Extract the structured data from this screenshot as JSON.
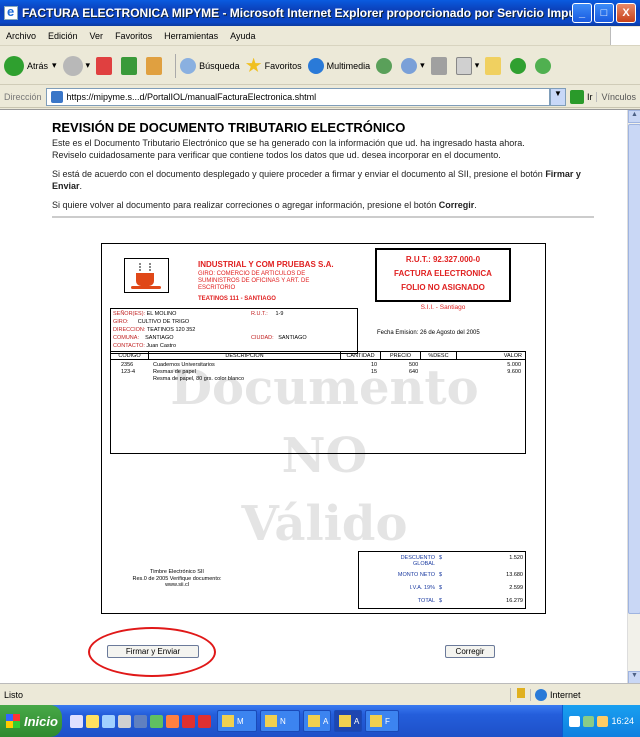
{
  "window": {
    "title": "FACTURA ELECTRONICA MIPYME - Microsoft Internet Explorer proporcionado por Servicio Impuestos Interno",
    "minimize": "_",
    "maximize": "□",
    "close": "X"
  },
  "menu": [
    "Archivo",
    "Edición",
    "Ver",
    "Favoritos",
    "Herramientas",
    "Ayuda"
  ],
  "toolbar": {
    "back": "Atrás",
    "search": "Búsqueda",
    "favorites": "Favoritos",
    "multimedia": "Multimedia"
  },
  "address": {
    "label": "Dirección",
    "url": "https://mipyme.s...d/PortalIOL/manualFacturaElectronica.shtml",
    "go": "Ir",
    "links": "Vínculos"
  },
  "page": {
    "heading": "REVISIÓN DE DOCUMENTO TRIBUTARIO ELECTRÓNICO",
    "intro1": "Este es el Documento Tributario Electrónico que se ha generado con la información que ud. ha ingresado hasta ahora.",
    "intro2": "Reviselo cuidadosamente para verificar que contiene todos los datos que ud. desea incorporar en el documento.",
    "sign1": "Si está de acuerdo con el documento desplegado y quiere proceder a firmar y enviar el documento al SII, presione el botón",
    "sign_btn_name": "Firmar y Enviar",
    "correct_text": "Si quiere volver al documento para realizar correciones o agregar información, presione el botón",
    "correct_btn_name": "Corregir"
  },
  "invoice": {
    "emisor_name": "INDUSTRIAL Y COM PRUEBAS S.A.",
    "emisor_giro": "GIRO: COMERCIO DE ARTICULOS DE SUMINISTROS DE OFICINAS Y ART. DE ESCRITORIO",
    "emisor_dir": "TEATINOS 111 - SANTIAGO",
    "rut": "R.U.T.: 92.327.000-0",
    "doc_type": "FACTURA ELECTRONICA",
    "folio": "FOLIO NO ASIGNADO",
    "sii": "S.I.I. - Santiago",
    "receptor": {
      "senores_k": "SEÑOR(ES):",
      "senores_v": "EL MOLINO",
      "rut_k": "R.U.T.:",
      "rut_v": "1-9",
      "giro_k": "GIRO:",
      "giro_v": "CULTIVO DE TRIGO",
      "dir_k": "DIRECCION:",
      "dir_v": "TEATINOS 120 352",
      "comuna_k": "COMUNA:",
      "comuna_v": "SANTIAGO",
      "ciudad_k": "CIUDAD:",
      "ciudad_v": "SANTIAGO",
      "contacto_k": "CONTACTO:",
      "contacto_v": "Juan Castro"
    },
    "fecha": "Fecha Emision: 26 de Agosto del 2005",
    "columns": [
      "CODIGO",
      "DESCRIPCION",
      "CANTIDAD",
      "PRECIO",
      "%DESC",
      "VALOR"
    ],
    "items": [
      {
        "codigo": "2356",
        "desc": "Cuadernos Universitarios",
        "cant": "10",
        "precio": "500",
        "valor": "5.000"
      },
      {
        "codigo": "123-4",
        "desc": "Resmas de papel",
        "cant": "15",
        "precio": "640",
        "valor": "9.600"
      }
    ],
    "item_note": "Resma de papel, 80 grs. color blanco",
    "watermark": [
      "Documento",
      "NO",
      "Válido"
    ],
    "timbre": [
      "Timbre Electrónico SII",
      "Res.0 de 2005 Verifique documento:",
      "www.sii.cl"
    ],
    "totals": [
      {
        "k": "DESCUENTO GLOBAL",
        "s": "$",
        "v": "1.520"
      },
      {
        "k": "MONTO NETO",
        "s": "$",
        "v": "13.680"
      },
      {
        "k": "I.V.A. 19%",
        "s": "$",
        "v": "2.599"
      },
      {
        "k": "TOTAL",
        "s": "$",
        "v": "16.279"
      }
    ]
  },
  "buttons": {
    "sign": "Firmar y Enviar",
    "correct": "Corregir"
  },
  "status": {
    "text": "Listo",
    "zone": "Internet"
  },
  "taskbar": {
    "start": "Inicio",
    "tasks": [
      "M",
      "N",
      "A",
      "A",
      "F"
    ],
    "clock": "16:24"
  },
  "colors": {
    "accent_red": "#e02020",
    "xp_blue": "#245edb",
    "highlight_ellipse": "#e01818"
  }
}
